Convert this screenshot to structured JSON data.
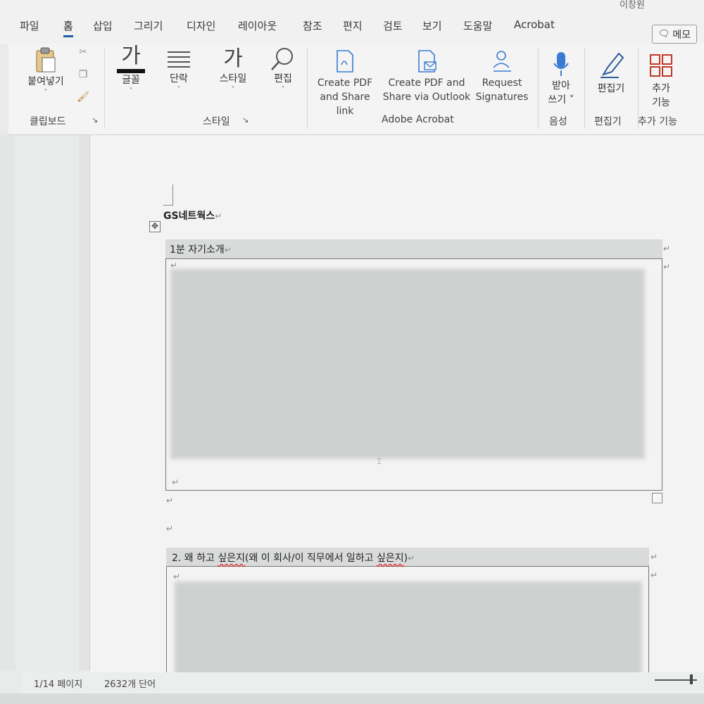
{
  "tabs": [
    "파일",
    "홈",
    "삽입",
    "그리기",
    "디자인",
    "레이아웃",
    "참조",
    "편지",
    "검토",
    "보기",
    "도움말",
    "Acrobat"
  ],
  "active_tab": "홈",
  "memo_label": "메모",
  "user_name": "이창원",
  "ribbon": {
    "clipboard": {
      "paste": "붙여넣기",
      "group": "클립보드"
    },
    "font": {
      "glyph": "가",
      "label": "글꼴"
    },
    "paragraph": {
      "label": "단락"
    },
    "styles": {
      "glyph": "가",
      "label": "스타일",
      "group": "스타일"
    },
    "editing": {
      "label": "편집"
    },
    "acrobat": {
      "create_pdf_line1": "Create PDF",
      "create_pdf_line2": "and Share link",
      "outlook_line1": "Create PDF and",
      "outlook_line2": "Share via Outlook",
      "request_line1": "Request",
      "request_line2": "Signatures",
      "group": "Adobe Acrobat"
    },
    "dictate": {
      "line1": "받아",
      "line2": "쓰기 ˅",
      "group": "음성"
    },
    "editor": {
      "label": "편집기",
      "group": "편집기"
    },
    "addins": {
      "line1": "추가",
      "line2": "기능",
      "group": "추가 기능"
    }
  },
  "document": {
    "company": "GS네트웍스",
    "section1_title": "1분 자기소개",
    "section2_title_a": "2. 왜 하고 ",
    "section2_title_b": "싶은지",
    "section2_title_c": "(왜 이 회사/이 직무에서 일하고 ",
    "section2_title_d": "싶은지",
    "section2_title_e": ")"
  },
  "status": {
    "page": "1/14 페이지",
    "words": "2632개 단어"
  },
  "colors": {
    "accent": "#1e5fa8",
    "header_fill": "#d9dbda"
  }
}
